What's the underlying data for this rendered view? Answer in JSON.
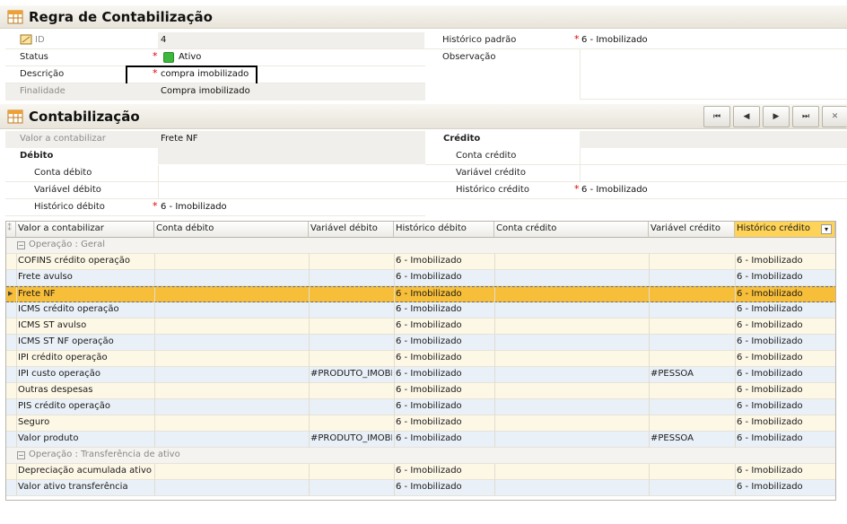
{
  "regra": {
    "title": "Regra de Contabilização",
    "id_label": "ID",
    "id_value": "4",
    "status_label": "Status",
    "status_value": "Ativo",
    "descricao_label": "Descrição",
    "descricao_value": "compra imobilizado",
    "finalidade_label": "Finalidade",
    "finalidade_value": "Compra imobilizado",
    "historico_label": "Histórico padrão",
    "historico_value": "6 - Imobilizado",
    "observacao_label": "Observação",
    "required_mark": "*"
  },
  "contab": {
    "title": "Contabilização",
    "nav": {
      "first": "⏮",
      "prev": "◀",
      "next": "▶",
      "last": "⏭",
      "close": "✕"
    },
    "valor_label": "Valor a contabilizar",
    "valor_value": "Frete NF",
    "debito_header": "Débito",
    "conta_debito_label": "Conta débito",
    "variavel_debito_label": "Variável débito",
    "historico_debito_label": "Histórico débito",
    "historico_debito_value": "6 - Imobilizado",
    "credito_header": "Crédito",
    "conta_credito_label": "Conta crédito",
    "variavel_credito_label": "Variável crédito",
    "historico_credito_label": "Histórico crédito",
    "historico_credito_value": "6 - Imobilizado"
  },
  "grid": {
    "columns": [
      "Valor a contabilizar",
      "Conta débito",
      "Variável débito",
      "Histórico débito",
      "Conta crédito",
      "Variável crédito",
      "Histórico crédito"
    ],
    "group1": "Operação : Geral",
    "group2": "Operação : Transferência de ativo",
    "rows": [
      [
        "COFINS crédito operação",
        "",
        "",
        "6 - Imobilizado",
        "",
        "",
        "6 - Imobilizado"
      ],
      [
        "Frete avulso",
        "",
        "",
        "6 - Imobilizado",
        "",
        "",
        "6 - Imobilizado"
      ],
      [
        "Frete NF",
        "",
        "",
        "6 - Imobilizado",
        "",
        "",
        "6 - Imobilizado"
      ],
      [
        "ICMS crédito operação",
        "",
        "",
        "6 - Imobilizado",
        "",
        "",
        "6 - Imobilizado"
      ],
      [
        "ICMS ST avulso",
        "",
        "",
        "6 - Imobilizado",
        "",
        "",
        "6 - Imobilizado"
      ],
      [
        "ICMS ST NF operação",
        "",
        "",
        "6 - Imobilizado",
        "",
        "",
        "6 - Imobilizado"
      ],
      [
        "IPI crédito operação",
        "",
        "",
        "6 - Imobilizado",
        "",
        "",
        "6 - Imobilizado"
      ],
      [
        "IPI custo operação",
        "",
        "#PRODUTO_IMOBI",
        "6 - Imobilizado",
        "",
        "#PESSOA",
        "6 - Imobilizado"
      ],
      [
        "Outras despesas",
        "",
        "",
        "6 - Imobilizado",
        "",
        "",
        "6 - Imobilizado"
      ],
      [
        "PIS crédito operação",
        "",
        "",
        "6 - Imobilizado",
        "",
        "",
        "6 - Imobilizado"
      ],
      [
        "Seguro",
        "",
        "",
        "6 - Imobilizado",
        "",
        "",
        "6 - Imobilizado"
      ],
      [
        "Valor produto",
        "",
        "#PRODUTO_IMOBI",
        "6 - Imobilizado",
        "",
        "#PESSOA",
        "6 - Imobilizado"
      ]
    ],
    "rows2": [
      [
        "Depreciação acumulada ativo t",
        "",
        "",
        "6 - Imobilizado",
        "",
        "",
        "6 - Imobilizado"
      ],
      [
        "Valor ativo transferência",
        "",
        "",
        "6 - Imobilizado",
        "",
        "",
        "6 - Imobilizado"
      ]
    ],
    "selected_index": 2
  },
  "colors": {
    "accent": "#ffd357",
    "selected_row": "#f7be39",
    "status_green": "#3db83d",
    "required": "#e00000"
  }
}
